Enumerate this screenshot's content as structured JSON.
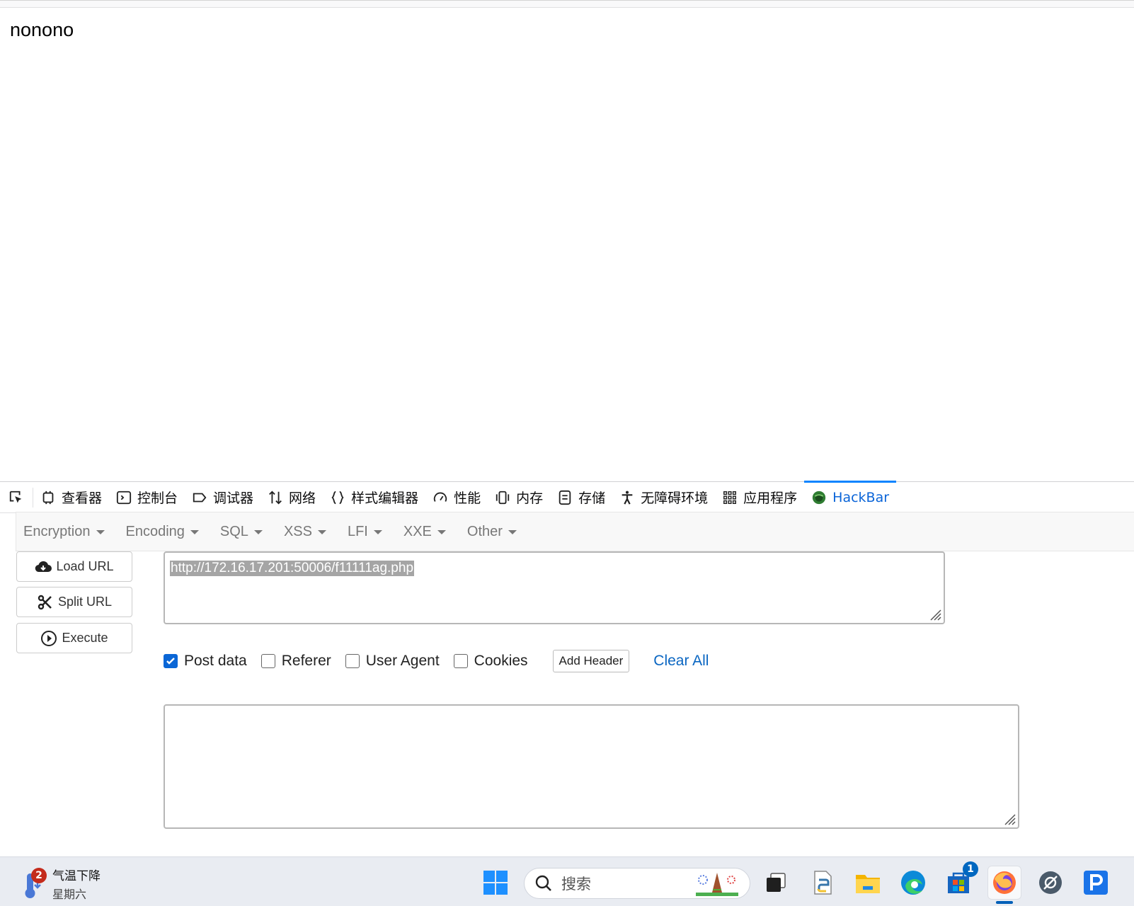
{
  "page": {
    "body_text": "nonono"
  },
  "devtools": {
    "tabs": [
      {
        "label": "查看器",
        "icon": "inspector-icon"
      },
      {
        "label": "控制台",
        "icon": "console-icon"
      },
      {
        "label": "调试器",
        "icon": "debugger-icon"
      },
      {
        "label": "网络",
        "icon": "network-icon"
      },
      {
        "label": "样式编辑器",
        "icon": "style-editor-icon"
      },
      {
        "label": "性能",
        "icon": "performance-icon"
      },
      {
        "label": "内存",
        "icon": "memory-icon"
      },
      {
        "label": "存储",
        "icon": "storage-icon"
      },
      {
        "label": "无障碍环境",
        "icon": "accessibility-icon"
      },
      {
        "label": "应用程序",
        "icon": "application-icon"
      },
      {
        "label": "HackBar",
        "icon": "hackbar-icon",
        "active": true
      }
    ]
  },
  "hackbar": {
    "menu": [
      "Encryption",
      "Encoding",
      "SQL",
      "XSS",
      "LFI",
      "XXE",
      "Other"
    ],
    "buttons": {
      "load_url": "Load URL",
      "split_url": "Split URL",
      "execute": "Execute"
    },
    "url_value": "http://172.16.17.201:50006/f11111ag.php",
    "options": {
      "post_data": {
        "label": "Post data",
        "checked": true
      },
      "referer": {
        "label": "Referer",
        "checked": false
      },
      "user_agent": {
        "label": "User Agent",
        "checked": false
      },
      "cookies": {
        "label": "Cookies",
        "checked": false
      }
    },
    "add_header": "Add Header",
    "clear_all": "Clear All",
    "post_value": ""
  },
  "taskbar": {
    "weather": {
      "title": "气温下降",
      "subtitle": "星期六",
      "badge": "2"
    },
    "search_placeholder": "搜索",
    "store_badge": "1"
  },
  "colors": {
    "accent": "#0a84ff",
    "hackbar_active": "#0a64d8",
    "checkbox_on": "#0a66d6",
    "link": "#0a66c2"
  }
}
